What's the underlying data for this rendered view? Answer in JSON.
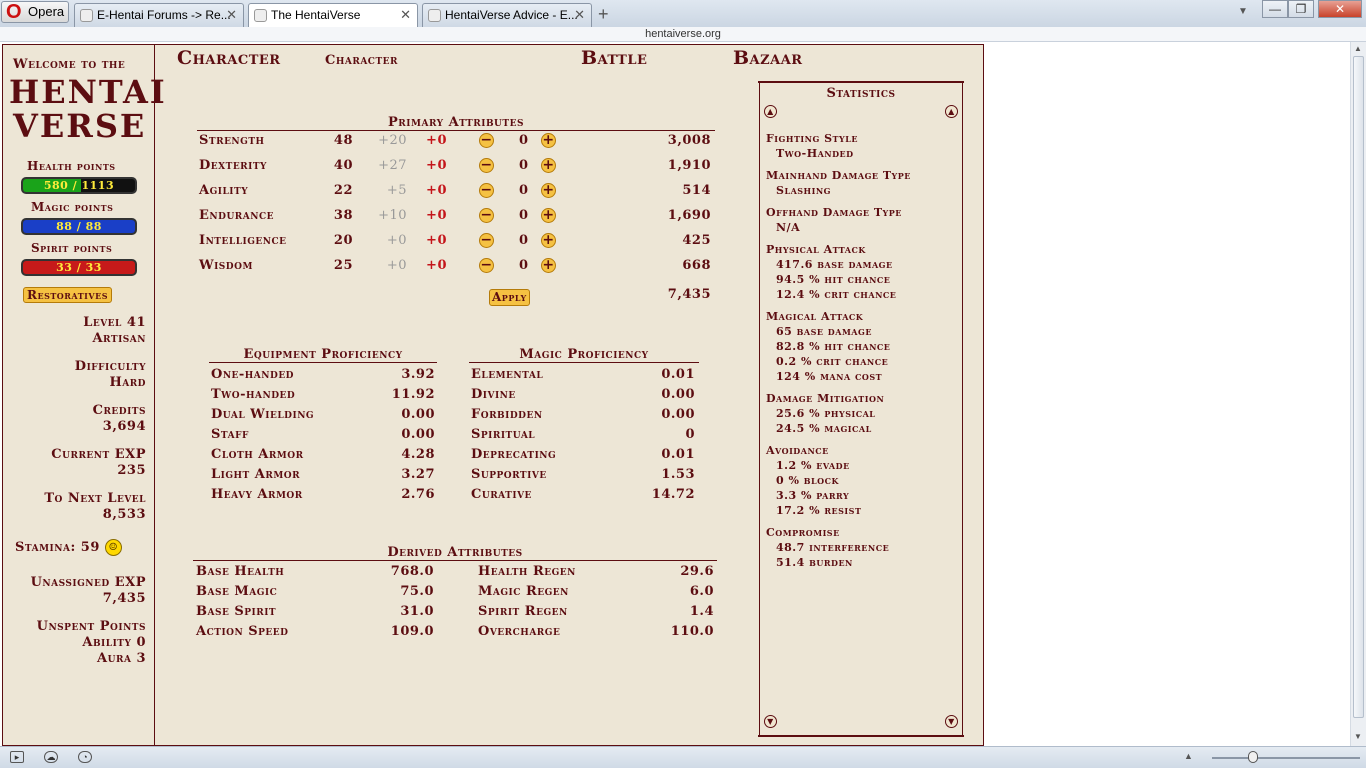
{
  "browser": {
    "opera_label": "Opera",
    "tabs": [
      {
        "title": "E-Hentai Forums -> Re..."
      },
      {
        "title": "The HentaiVerse"
      },
      {
        "title": "HentaiVerse Advice - E..."
      }
    ],
    "new_tab": "+",
    "address": "hentaiverse.org",
    "window_controls": {
      "minimize": "—",
      "maximize": "❐",
      "close": "✕"
    }
  },
  "sidebar": {
    "welcome": "Welcome to the",
    "logo_line1": "HENTAI",
    "logo_line2": "VERSE",
    "health_label": "Health points",
    "health": "580 / 1113",
    "health_fraction": 0.521,
    "magic_label": "Magic points",
    "magic": "88 / 88",
    "magic_fraction": 1.0,
    "spirit_label": "Spirit points",
    "spirit": "33 / 33",
    "spirit_fraction": 1.0,
    "restoratives": "Restoratives",
    "level": "Level 41",
    "title": "Artisan",
    "difficulty_label": "Difficulty",
    "difficulty": "Hard",
    "credits_label": "Credits",
    "credits": "3,694",
    "current_exp_label": "Current EXP",
    "current_exp": "235",
    "next_level_label": "To Next Level",
    "next_level": "8,533",
    "stamina": "Stamina: 59",
    "unassigned_exp_label": "Unassigned EXP",
    "unassigned_exp": "7,435",
    "unspent_points_label": "Unspent Points",
    "ability": "Ability 0",
    "aura": "Aura 3",
    "colors": {
      "health": "#1aa31a",
      "magic": "#1a3fc7",
      "spirit": "#c71a1a"
    }
  },
  "nav": {
    "character": "Character",
    "character_sub": "Character",
    "battle": "Battle",
    "bazaar": "Bazaar"
  },
  "primary": {
    "title": "Primary Attributes",
    "rows": [
      {
        "name": "Strength",
        "base": "48",
        "mod": "+20",
        "plus": "+0",
        "alloc": "0",
        "minus_btn": "−",
        "plus_btn": "+",
        "total": "3,008"
      },
      {
        "name": "Dexterity",
        "base": "40",
        "mod": "+27",
        "plus": "+0",
        "alloc": "0",
        "minus_btn": "−",
        "plus_btn": "+",
        "total": "1,910"
      },
      {
        "name": "Agility",
        "base": "22",
        "mod": "+5",
        "plus": "+0",
        "alloc": "0",
        "minus_btn": "−",
        "plus_btn": "+",
        "total": "514"
      },
      {
        "name": "Endurance",
        "base": "38",
        "mod": "+10",
        "plus": "+0",
        "alloc": "0",
        "minus_btn": "−",
        "plus_btn": "+",
        "total": "1,690"
      },
      {
        "name": "Intelligence",
        "base": "20",
        "mod": "+0",
        "plus": "+0",
        "alloc": "0",
        "minus_btn": "−",
        "plus_btn": "+",
        "total": "425"
      },
      {
        "name": "Wisdom",
        "base": "25",
        "mod": "+0",
        "plus": "+0",
        "alloc": "0",
        "minus_btn": "−",
        "plus_btn": "+",
        "total": "668"
      }
    ],
    "apply": "Apply",
    "apply_total": "7,435"
  },
  "equipment": {
    "title": "Equipment Proficiency",
    "rows": [
      {
        "name": "One-handed",
        "value": "3.92"
      },
      {
        "name": "Two-handed",
        "value": "11.92"
      },
      {
        "name": "Dual Wielding",
        "value": "0.00"
      },
      {
        "name": "Staff",
        "value": "0.00"
      },
      {
        "name": "Cloth Armor",
        "value": "4.28"
      },
      {
        "name": "Light Armor",
        "value": "3.27"
      },
      {
        "name": "Heavy Armor",
        "value": "2.76"
      }
    ]
  },
  "magic_prof": {
    "title": "Magic Proficiency",
    "rows": [
      {
        "name": "Elemental",
        "value": "0.01"
      },
      {
        "name": "Divine",
        "value": "0.00"
      },
      {
        "name": "Forbidden",
        "value": "0.00"
      },
      {
        "name": "Spiritual",
        "value": "0"
      },
      {
        "name": "Deprecating",
        "value": "0.01"
      },
      {
        "name": "Supportive",
        "value": "1.53"
      },
      {
        "name": "Curative",
        "value": "14.72"
      }
    ]
  },
  "derived": {
    "title": "Derived Attributes",
    "rows": [
      {
        "name": "Base Health",
        "value": "768.0",
        "name2": "Health Regen",
        "value2": "29.6"
      },
      {
        "name": "Base Magic",
        "value": "75.0",
        "name2": "Magic Regen",
        "value2": "6.0"
      },
      {
        "name": "Base Spirit",
        "value": "31.0",
        "name2": "Spirit Regen",
        "value2": "1.4"
      },
      {
        "name": "Action Speed",
        "value": "109.0",
        "name2": "Overcharge",
        "value2": "110.0"
      }
    ]
  },
  "statistics": {
    "title": "Statistics",
    "lines": [
      {
        "text": "Fighting Style",
        "indent": false
      },
      {
        "text": "Two-Handed",
        "indent": true
      },
      {
        "text": "Mainhand Damage Type",
        "indent": false
      },
      {
        "text": "Slashing",
        "indent": true
      },
      {
        "text": "Offhand Damage Type",
        "indent": false
      },
      {
        "text": "N/A",
        "indent": true
      },
      {
        "text": "Physical Attack",
        "indent": false
      },
      {
        "text": "417.6 base damage",
        "indent": true
      },
      {
        "text": "94.5 % hit chance",
        "indent": true
      },
      {
        "text": "12.4 % crit chance",
        "indent": true
      },
      {
        "text": "Magical Attack",
        "indent": false
      },
      {
        "text": "65 base damage",
        "indent": true
      },
      {
        "text": "82.8 % hit chance",
        "indent": true
      },
      {
        "text": "0.2 % crit chance",
        "indent": true
      },
      {
        "text": "124 % mana cost",
        "indent": true
      },
      {
        "text": "Damage Mitigation",
        "indent": false
      },
      {
        "text": "25.6 % physical",
        "indent": true
      },
      {
        "text": "24.5 % magical",
        "indent": true
      },
      {
        "text": "Avoidance",
        "indent": false
      },
      {
        "text": "1.2 % evade",
        "indent": true
      },
      {
        "text": "0 % block",
        "indent": true
      },
      {
        "text": "3.3 % parry",
        "indent": true
      },
      {
        "text": "17.2 % resist",
        "indent": true
      },
      {
        "text": "Compromise",
        "indent": false
      },
      {
        "text": "48.7 interference",
        "indent": true
      },
      {
        "text": "51.4 burden",
        "indent": true
      }
    ],
    "arrow_up": "▲",
    "arrow_down": "▼"
  },
  "colors": {
    "accent": "#5c0d11",
    "background": "#ede6d6",
    "button": "#f5c142",
    "bonus": "#c4141a"
  }
}
